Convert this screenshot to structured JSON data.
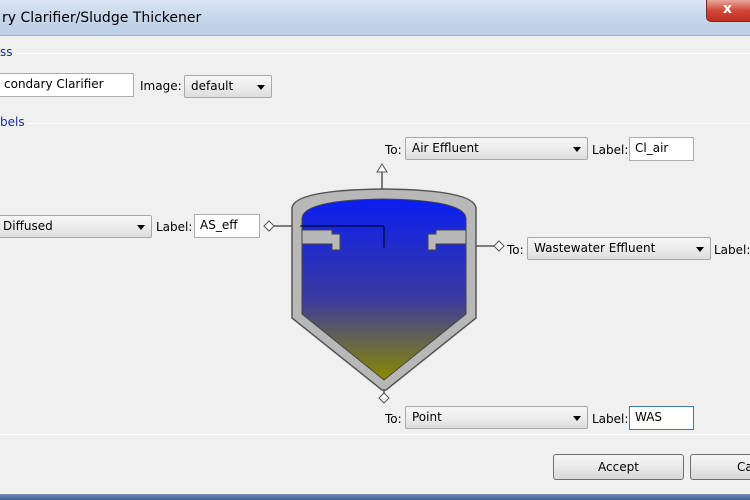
{
  "window": {
    "title": "ry Clarifier/Sludge Thickener",
    "close_glyph": "x"
  },
  "sections": {
    "class_label": "ss",
    "labels_label": "bels"
  },
  "class_row": {
    "name_value": "condary Clarifier",
    "image_label": "Image:",
    "image_value": "default"
  },
  "connections": {
    "top": {
      "to_label": "To:",
      "to_value": "Air Effluent",
      "label_label": "Label:",
      "label_value": "Cl_air"
    },
    "left": {
      "to_value": "Diffused",
      "label_label": "Label:",
      "label_value": "AS_eff"
    },
    "right": {
      "to_label": "To:",
      "to_value": "Wastewater Effluent",
      "label_label": "Label:"
    },
    "bottom": {
      "to_label": "To:",
      "to_value": "Point",
      "label_label": "Label:",
      "label_value": "WAS"
    }
  },
  "buttons": {
    "accept": "Accept",
    "cancel": "Ca"
  },
  "colors": {
    "tank_top": "#0a1ef0",
    "tank_bottom": "#8a8a00",
    "shell": "#b8b8b8"
  }
}
